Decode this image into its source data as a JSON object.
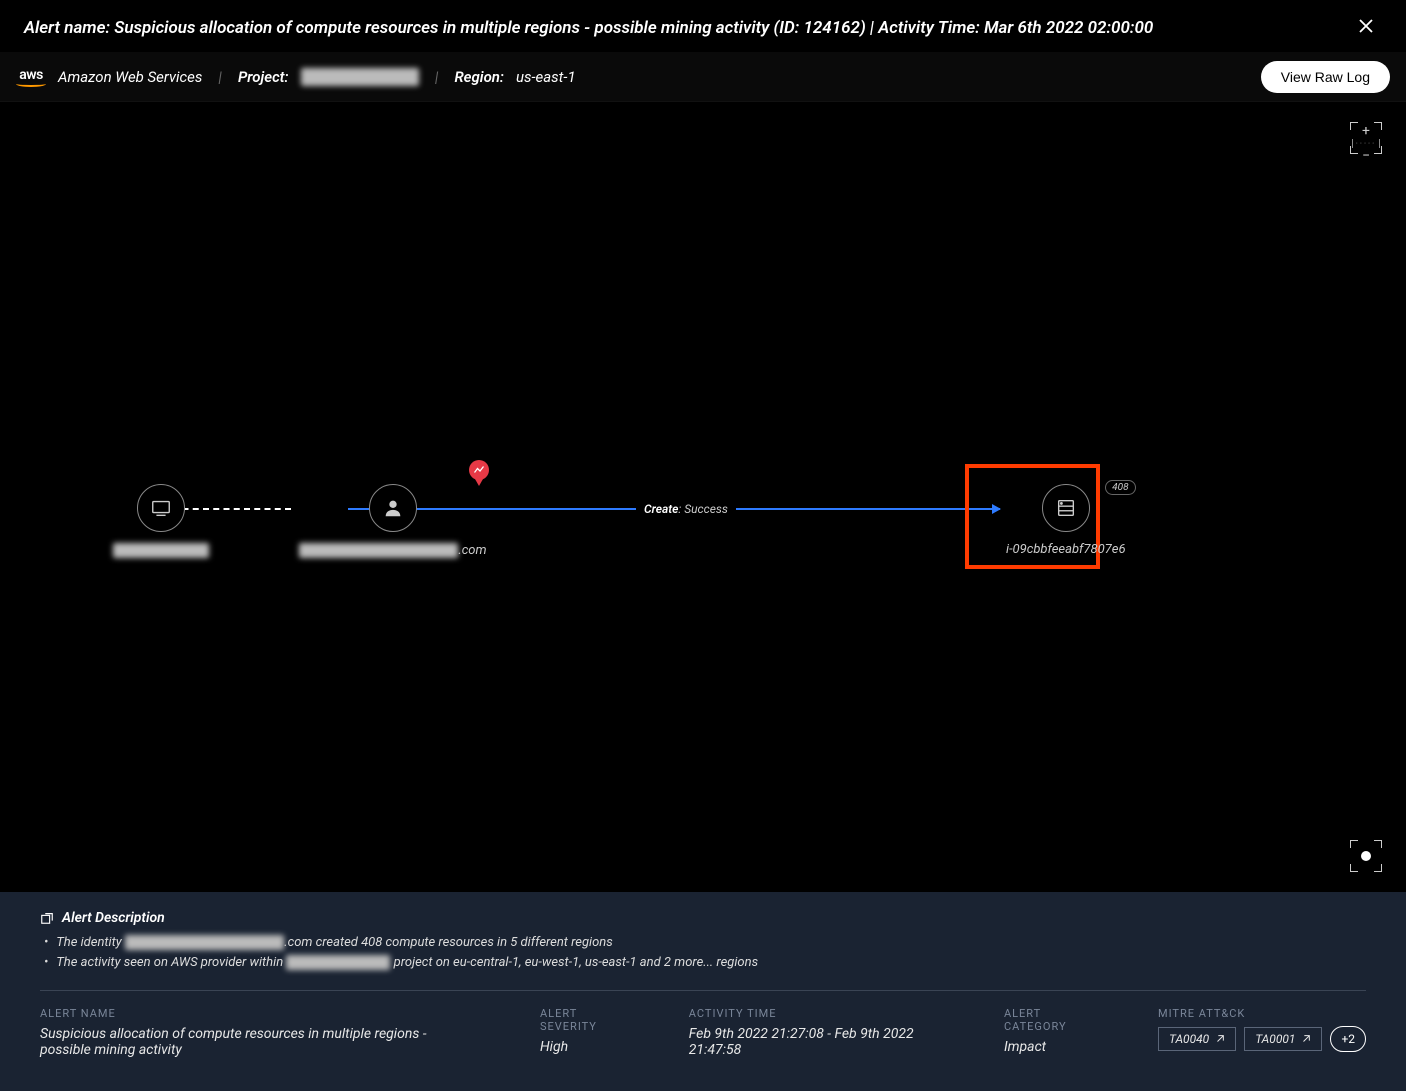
{
  "header": {
    "title": "Alert name: Suspicious allocation of compute resources in multiple regions - possible mining activity (ID: 124162) | Activity Time: Mar 6th 2022 02:00:00"
  },
  "subheader": {
    "provider": "Amazon Web Services",
    "project_label": "Project:",
    "project_value": "██████████",
    "region_label": "Region:",
    "region_value": "us-east-1",
    "view_log": "View Raw Log"
  },
  "graph": {
    "node1_label": "██-██-██-██",
    "node2_label_prefix": "████████████████",
    "node2_label_suffix": ".com",
    "node3_label": "i-09cbbfeeabf7807e6",
    "node3_count": "408",
    "edge_create": "Create",
    "edge_success": ": Success"
  },
  "description": {
    "header": "Alert Description",
    "line1_a": "The identity ",
    "line1_redacted": "████████████████",
    "line1_b": ".com created 408 compute resources in 5 different regions",
    "line2_a": "The activity seen on AWS provider within ",
    "line2_redacted": "██████████",
    "line2_b": " project on eu-central-1, eu-west-1, us-east-1 and 2 more... regions"
  },
  "meta": {
    "alert_name_label": "ALERT NAME",
    "alert_name_value": "Suspicious allocation of compute resources in multiple regions - possible mining activity",
    "severity_label": "ALERT SEVERITY",
    "severity_value": "High",
    "time_label": "ACTIVITY TIME",
    "time_value": "Feb 9th 2022 21:27:08 - Feb 9th 2022 21:47:58",
    "category_label": "ALERT CATEGORY",
    "category_value": "Impact",
    "mitre_label": "MITRE ATT&CK",
    "mitre_tags": [
      "TA0040",
      "TA0001"
    ],
    "mitre_more": "+2"
  }
}
